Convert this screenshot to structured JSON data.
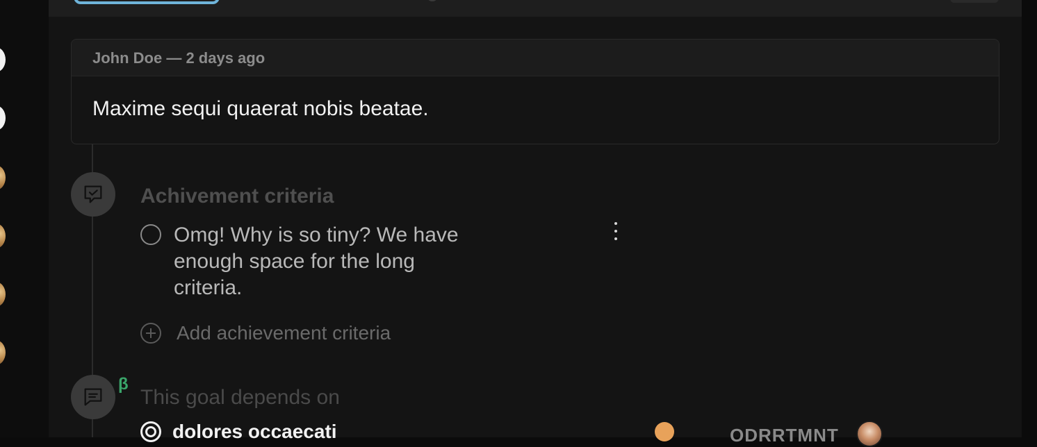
{
  "comment": {
    "author_meta": "John Doe — 2 days ago",
    "body": "Maxime sequi quaerat nobis beatae."
  },
  "achievement": {
    "title": "Achivement criteria",
    "items": [
      {
        "text": "Omg! Why is so tiny? We have enough space for the long criteria."
      }
    ],
    "add_label": "Add achievement criteria"
  },
  "dependencies": {
    "title": "This goal depends on",
    "beta_label": "β",
    "items": [
      {
        "title": "dolores occaecati",
        "project": "ODRRTMNT"
      }
    ]
  },
  "colors": {
    "accent_blue": "#6fb4da",
    "beta_green": "#3aa56a",
    "status_orange": "#e8a25a"
  }
}
